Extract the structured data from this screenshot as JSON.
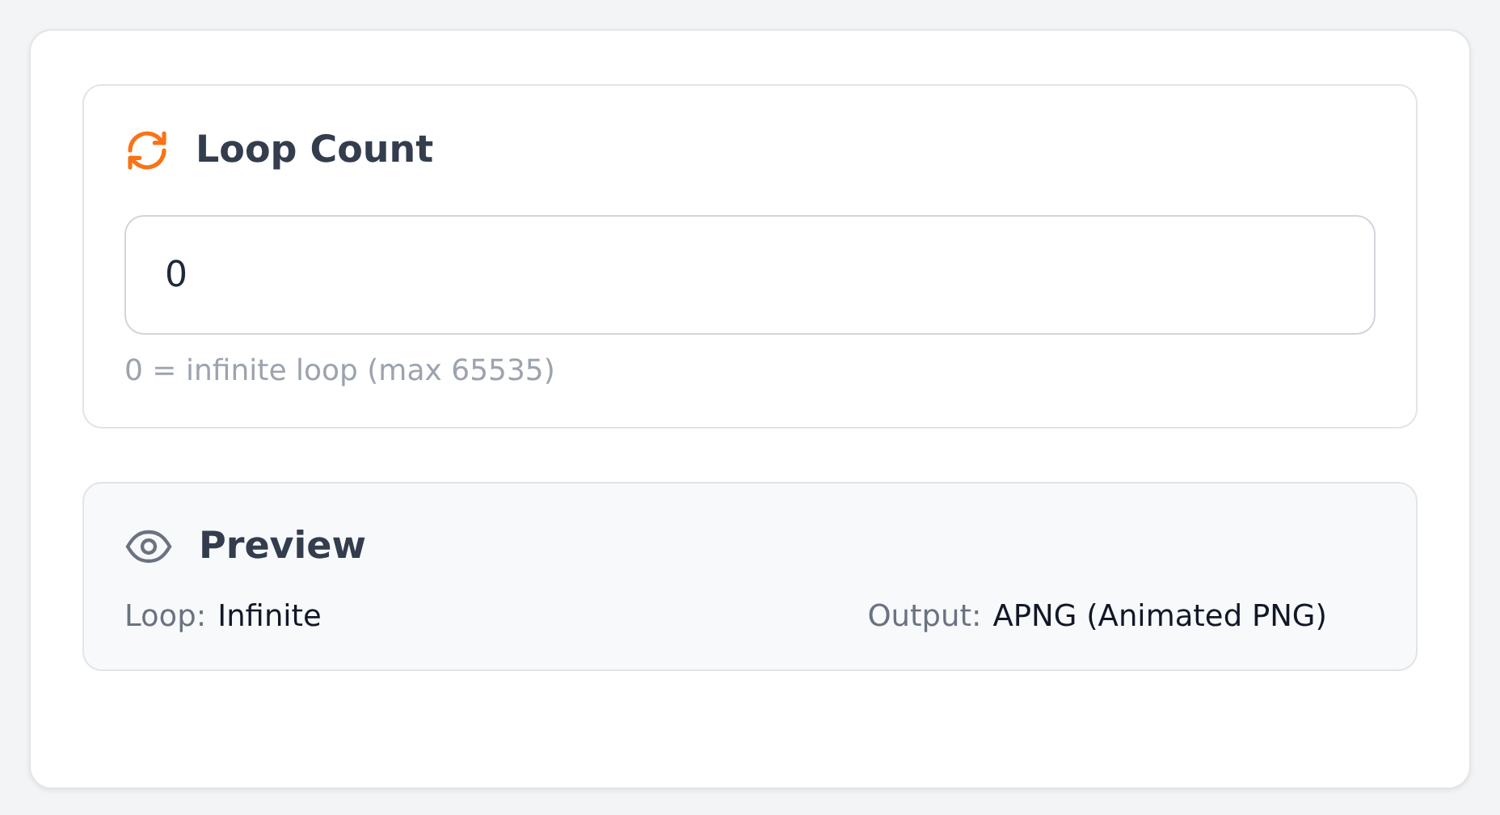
{
  "loop_count": {
    "title": "Loop Count",
    "value": "0",
    "hint": "0 = infinite loop (max 65535)"
  },
  "preview": {
    "title": "Preview",
    "items": [
      {
        "label": "Loop:",
        "value": "Infinite"
      },
      {
        "label": "Output:",
        "value": "APNG (Animated PNG)"
      }
    ]
  }
}
